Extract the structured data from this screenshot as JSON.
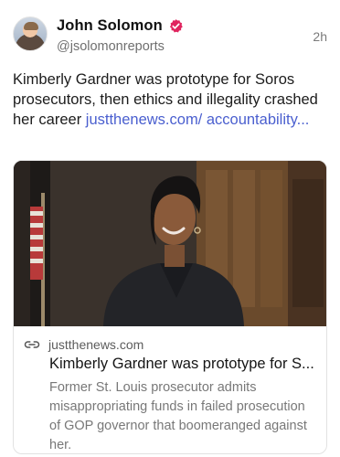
{
  "post": {
    "author_name": "John Solomon",
    "author_handle": "@jsolomonreports",
    "verified_icon": "verified-badge-icon",
    "time": "2h",
    "text": "Kimberly Gardner was prototype for Soros prosecutors, then ethics and illegality crashed her career ",
    "link_text": "justthenews.com/ accountability...",
    "colors": {
      "link": "#4a5fcf",
      "verified": "#e0245e"
    }
  },
  "card": {
    "image_icon": "photo-woman-courtroom",
    "link_icon": "link-icon",
    "domain": "justthenews.com",
    "title": "Kimberly Gardner was prototype for S...",
    "description": "Former St. Louis prosecutor admits misappropriating funds in failed prosecution of GOP governor that boomeranged against her."
  }
}
